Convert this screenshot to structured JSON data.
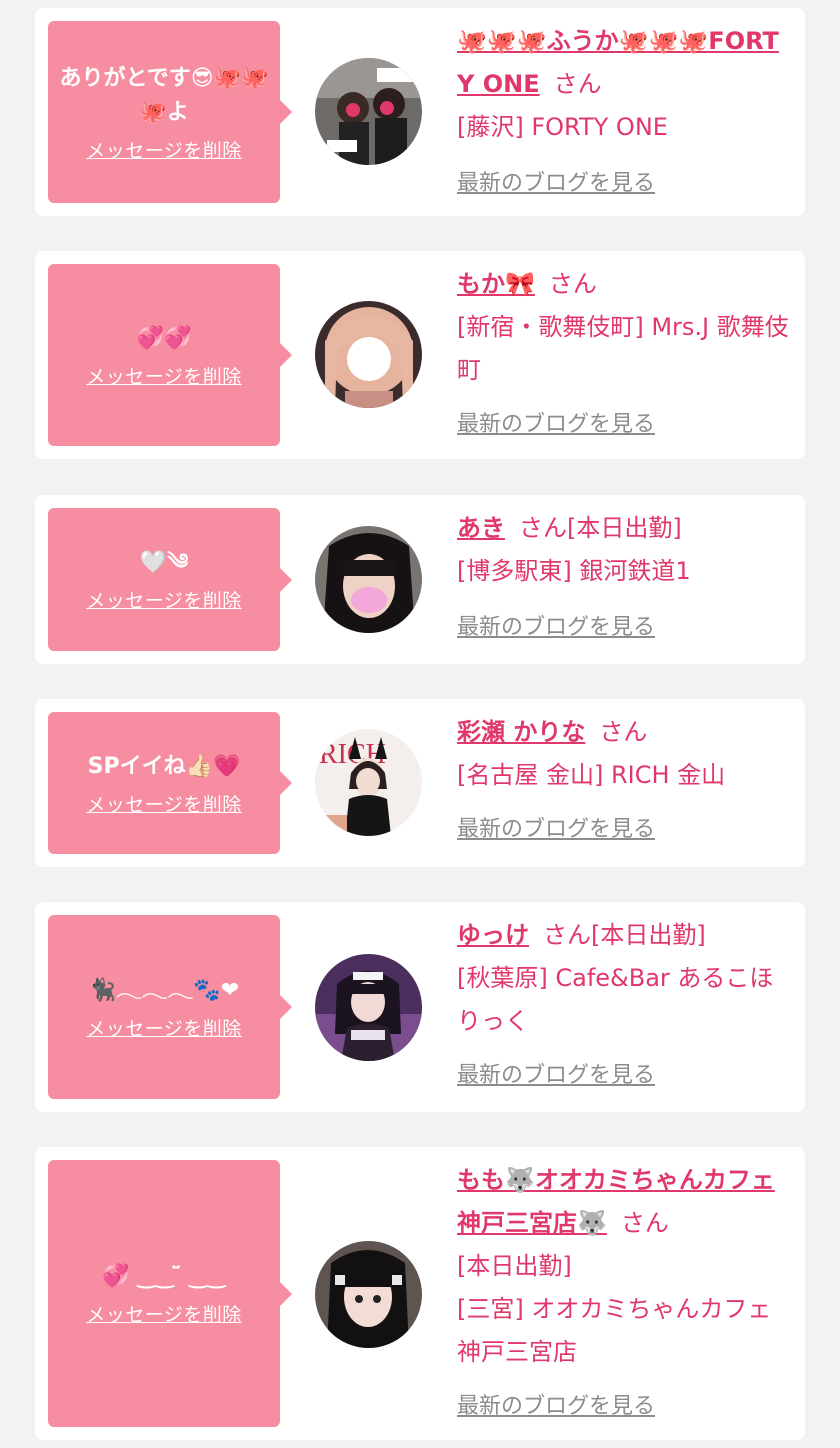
{
  "cards": [
    {
      "message": "ありがとです😎🐙🐙🐙よ",
      "delete_label": "メッセージを削除",
      "name": "🐙🐙🐙ふうか🐙🐙🐙FORTY ONE",
      "honorific": "さん",
      "status": "",
      "shop": "[藤沢] FORTY ONE",
      "blog_link": "最新のブログを見る"
    },
    {
      "message": "💞💞",
      "delete_label": "メッセージを削除",
      "name": "もか🎀",
      "honorific": "さん",
      "status": "",
      "shop": "[新宿・歌舞伎町] Mrs.J 歌舞伎町",
      "blog_link": "最新のブログを見る"
    },
    {
      "message": "🤍༄",
      "delete_label": "メッセージを削除",
      "name": "あき",
      "honorific": "さん",
      "status": "[本日出勤]",
      "shop": "[博多駅東] 銀河鉄道1",
      "blog_link": "最新のブログを見る"
    },
    {
      "message": "SPイイね👍🏻💗",
      "delete_label": "メッセージを削除",
      "name": "彩瀬 かりな",
      "honorific": "さん",
      "status": "",
      "shop": "[名古屋 金山] RICH 金山",
      "blog_link": "最新のブログを見る"
    },
    {
      "message": "🐈‍⬛𓂃𓂃𓂃🐾❤",
      "delete_label": "メッセージを削除",
      "name": "ゆっけ",
      "honorific": "さん",
      "status": "[本日出勤]",
      "shop": "[秋葉原] Cafe&Bar あるこほりっく",
      "blog_link": "最新のブログを見る"
    },
    {
      "message": "💞 ‿‿ ̆̈ ‿‿",
      "delete_label": "メッセージを削除",
      "name": "もも🐺オオカミちゃんカフェ神戸三宮店🐺",
      "honorific": "さん",
      "status": "[本日出勤]",
      "shop": "[三宮] オオカミちゃんカフェ神戸三宮店",
      "blog_link": "最新のブログを見る"
    }
  ]
}
